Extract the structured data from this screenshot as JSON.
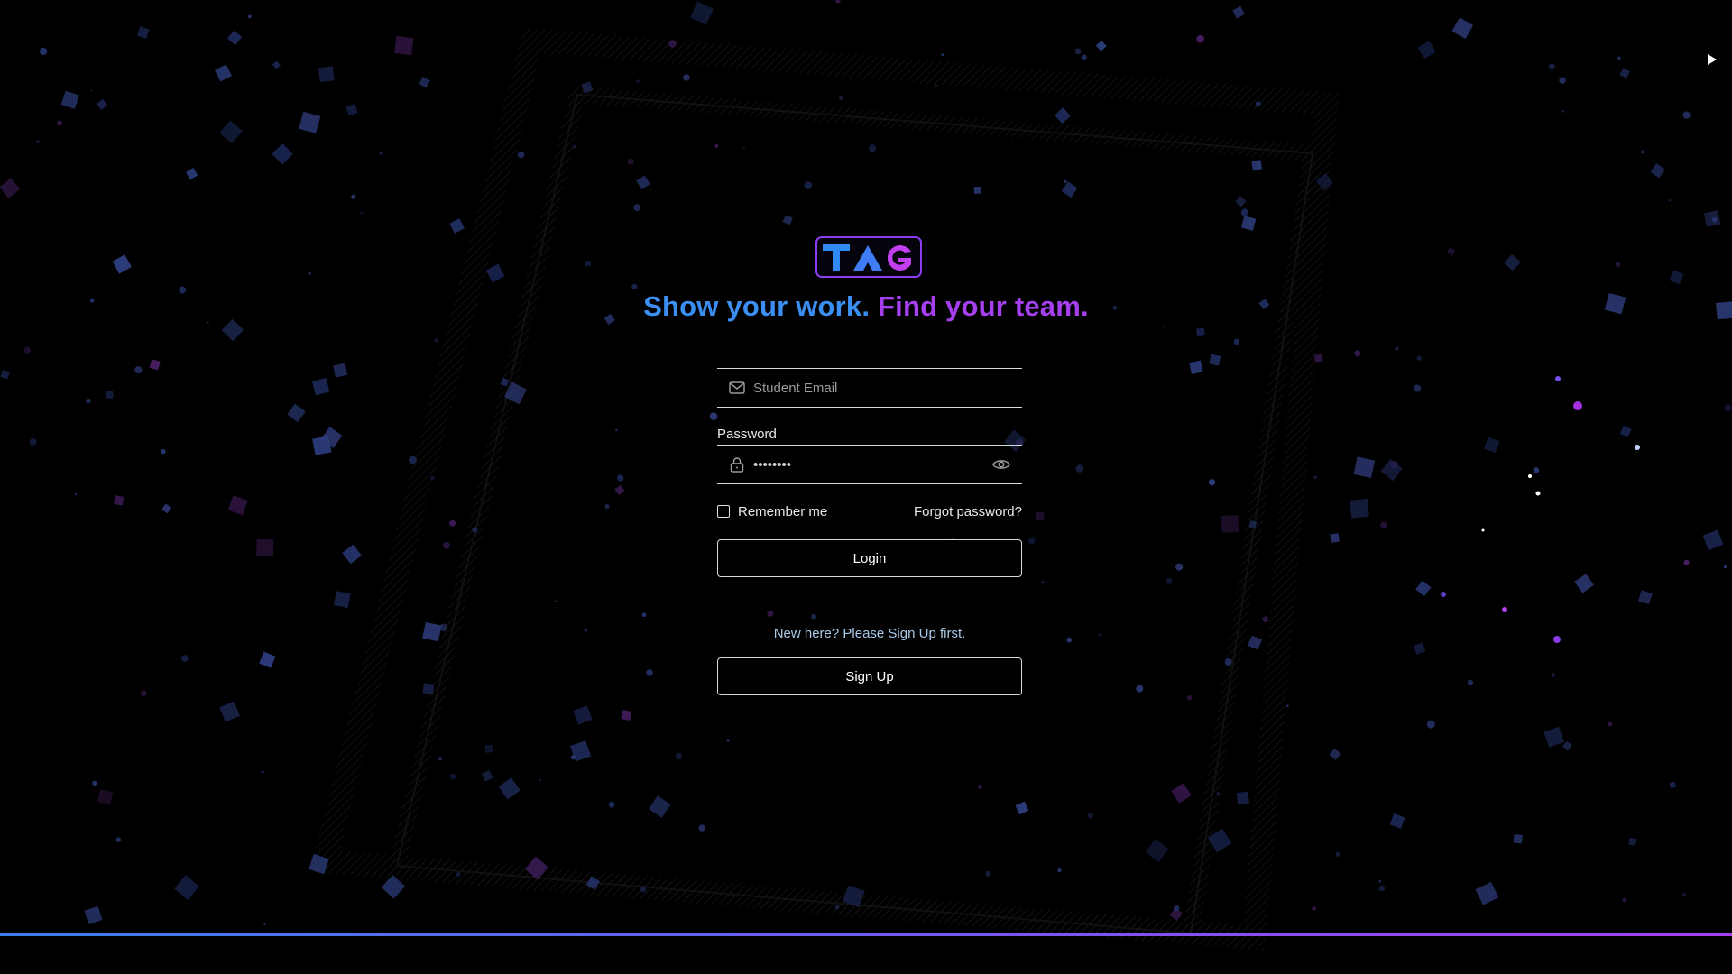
{
  "page": {
    "tagline_part1": "Show your work.",
    "tagline_part2": "Find your team."
  },
  "logo": {
    "text": "TAG"
  },
  "form": {
    "email_placeholder": "Student Email",
    "email_value": "",
    "password_label": "Password",
    "password_value": "••••••••",
    "remember_label": "Remember me",
    "forgot_label": "Forgot password?",
    "login_label": "Login",
    "signup_prompt": "New here? Please Sign Up first.",
    "signup_label": "Sign Up"
  },
  "icons": {
    "email": "mail-icon",
    "password": "lock-icon",
    "toggle_visibility": "eye-icon",
    "media": "play-icon"
  },
  "colors": {
    "background": "#000000",
    "accent_blue": "#3b8ef2",
    "accent_purple": "#a53ff0",
    "border": "#d9d9d9",
    "prompt_text": "#a9c9e8"
  }
}
